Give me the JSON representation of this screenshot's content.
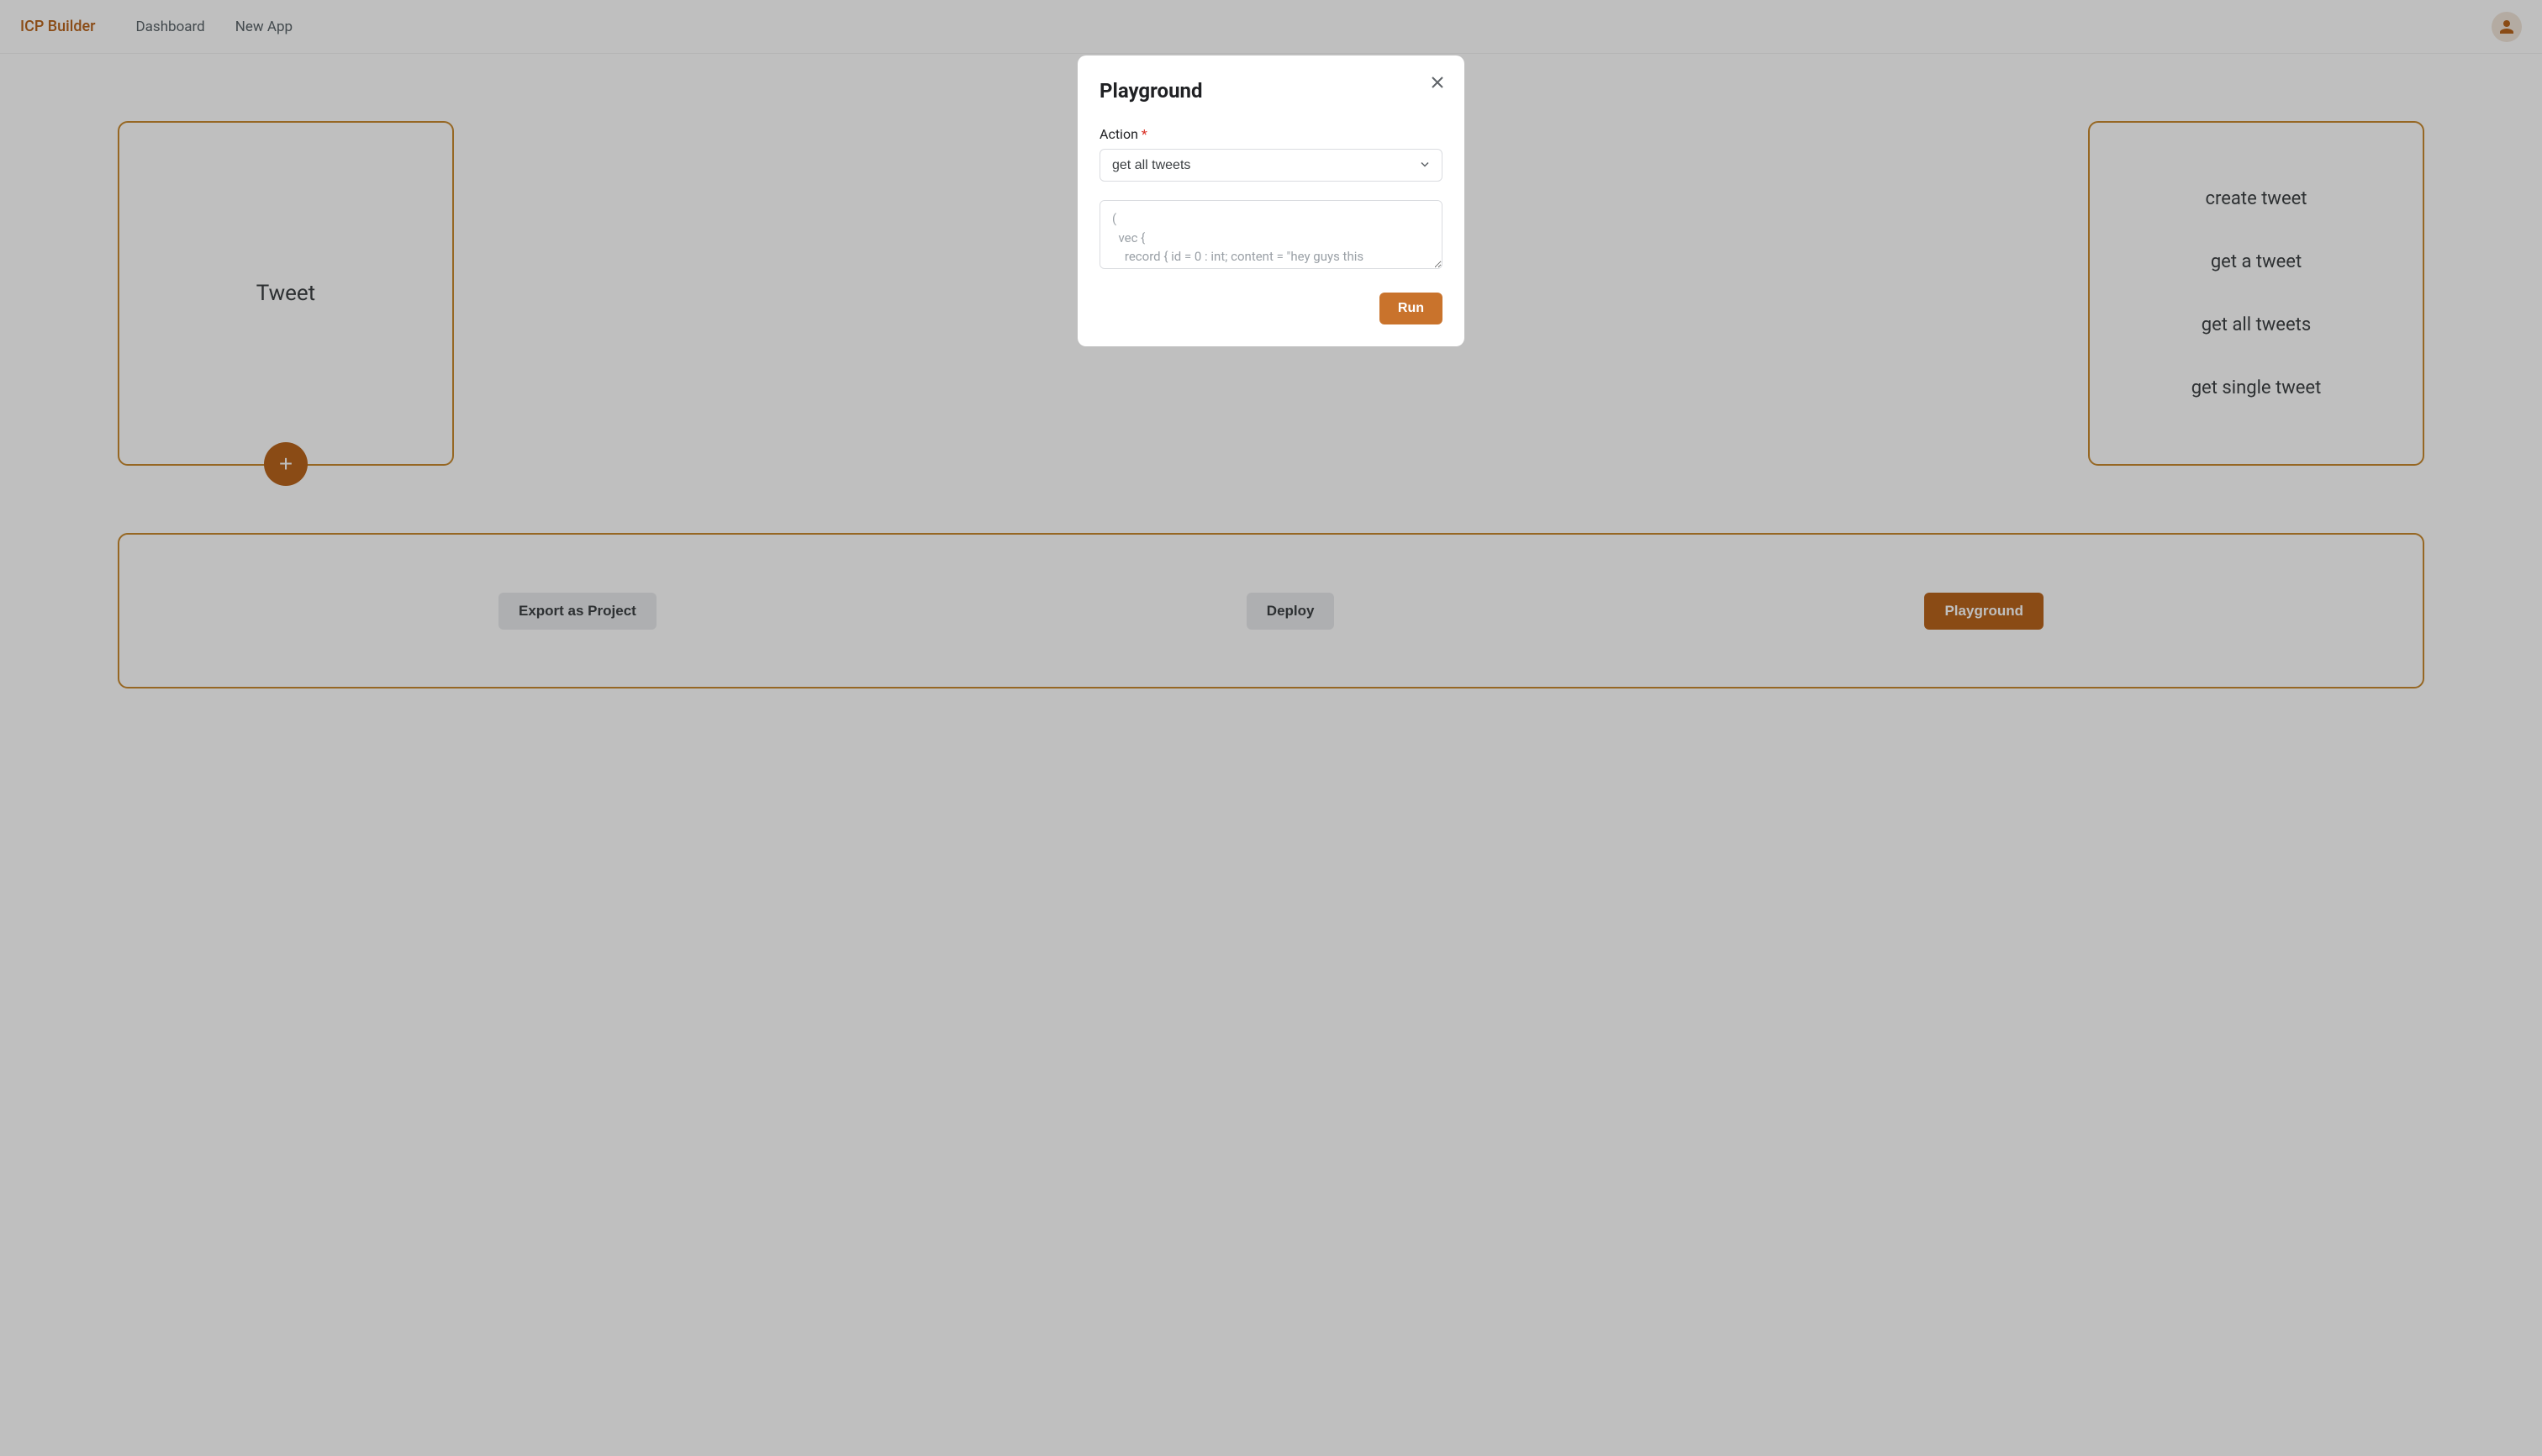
{
  "navbar": {
    "brand": "ICP Builder",
    "links": [
      "Dashboard",
      "New App"
    ]
  },
  "leftCard": {
    "title": "Tweet"
  },
  "rightCard": {
    "actions": [
      "create tweet",
      "get a tweet",
      "get all tweets",
      "get single tweet"
    ]
  },
  "bottomButtons": {
    "export": "Export as Project",
    "deploy": "Deploy",
    "playground": "Playground"
  },
  "modal": {
    "title": "Playground",
    "actionLabel": "Action",
    "selectedAction": "get all tweets",
    "textareaPlaceholder": "(\n  vec {\n    record { id = 0 : int; content = \"hey guys this",
    "runButton": "Run"
  }
}
